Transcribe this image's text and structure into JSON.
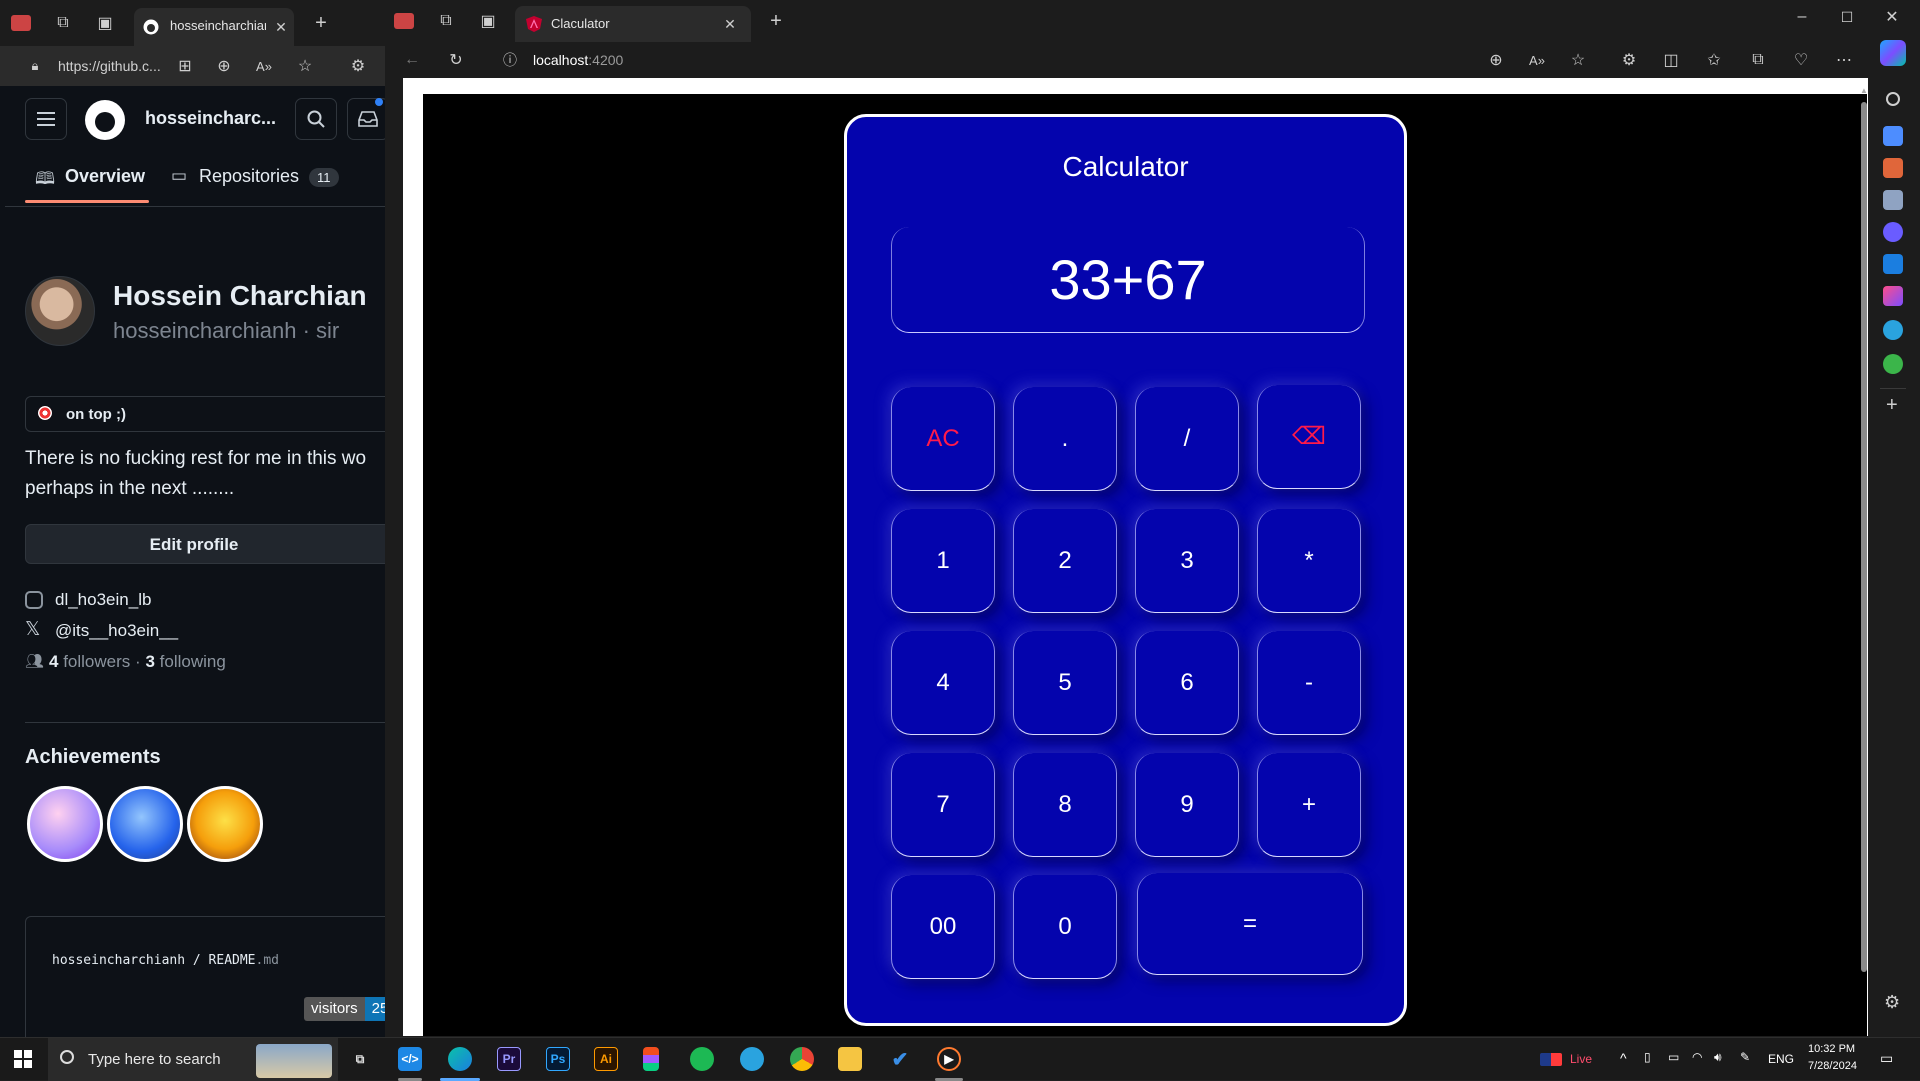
{
  "left_browser": {
    "tab_title": "hosseincharchianh",
    "url": "https://github.c...",
    "github": {
      "username_short": "hosseincharc...",
      "tabs": [
        {
          "label": "Overview"
        },
        {
          "label": "Repositories",
          "count": "11"
        }
      ],
      "profile_name": "Hossein Charchian",
      "profile_login": "hosseincharchianh · sir",
      "status_text": "on top ;)",
      "bio_line1": "There is no fucking rest for me in this wo",
      "bio_line2": "perhaps in the next ........",
      "edit_profile_label": "Edit profile",
      "instagram": "dl_ho3ein_lb",
      "twitter": "@its__ho3ein__",
      "followers_count": "4",
      "followers_label": "followers",
      "following_count": "3",
      "following_label": "following",
      "separator": "·",
      "achievements_title": "Achievements",
      "readme_owner": "hosseincharchianh",
      "readme_slash": " / ",
      "readme_file": "README",
      "readme_ext": ".md",
      "visitors_label": "visitors",
      "visitors_count": "25"
    }
  },
  "right_browser": {
    "tab_title": "Claculator",
    "url": "localhost",
    "url_port": ":4200"
  },
  "calculator": {
    "title": "Calculator",
    "display": "33+67",
    "keys": {
      "ac": "AC",
      "dot": ".",
      "divide": "/",
      "backspace": "⌫",
      "k1": "1",
      "k2": "2",
      "k3": "3",
      "multiply": "*",
      "k4": "4",
      "k5": "5",
      "k6": "6",
      "minus": "-",
      "k7": "7",
      "k8": "8",
      "k9": "9",
      "plus": "+",
      "k00": "00",
      "k0": "0",
      "equals": "="
    },
    "colors": {
      "body": "#0404ad",
      "accent_red": "#ff1a4a"
    }
  },
  "taskbar": {
    "search_placeholder": "Type here to search",
    "live_label": "Live",
    "language": "ENG",
    "time": "10:32 PM",
    "date": "7/28/2024",
    "apps": [
      "Pr",
      "Ps",
      "Ai"
    ]
  }
}
